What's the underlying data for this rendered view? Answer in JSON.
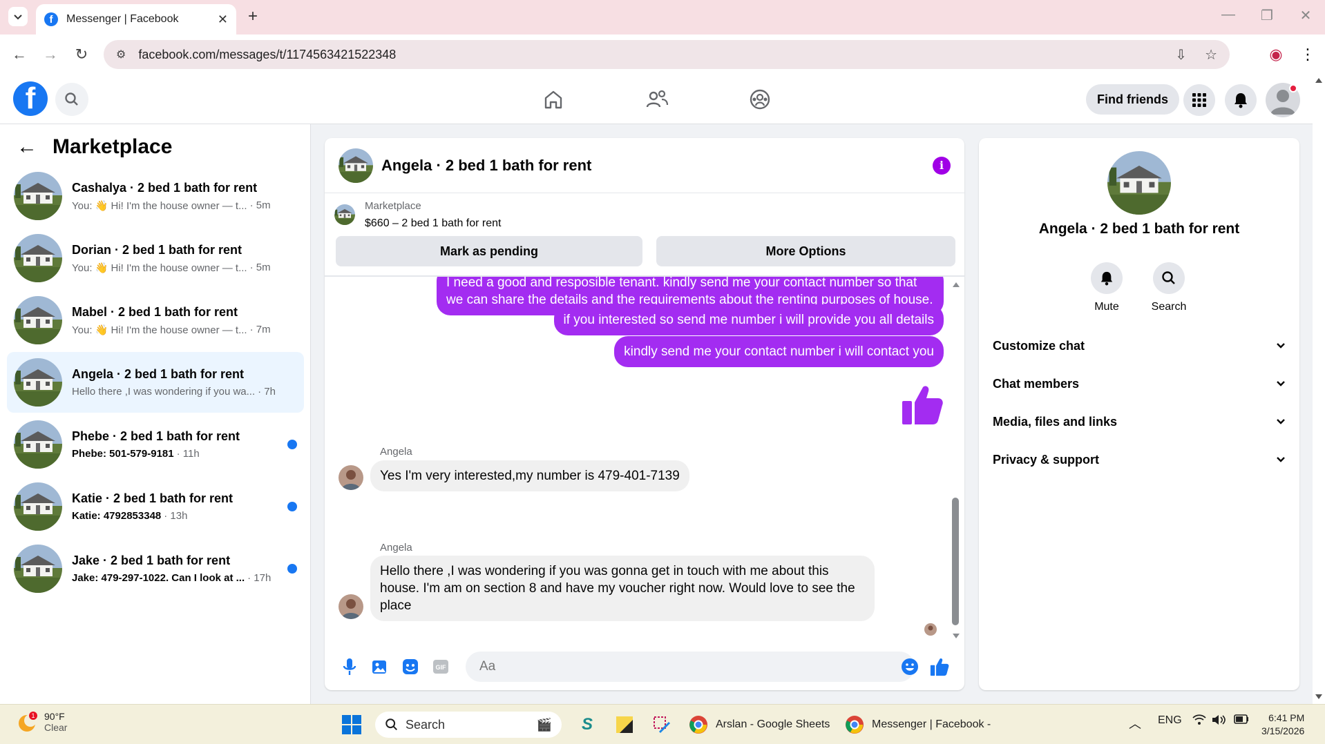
{
  "browser": {
    "tab_title": "Messenger | Facebook",
    "url": "facebook.com/messages/t/1174563421522348"
  },
  "fbnav": {
    "find_friends": "Find friends"
  },
  "sidebar": {
    "title": "Marketplace",
    "conversations": [
      {
        "name": "Cashalya · 2 bed 1 bath for rent",
        "preview": "You: 👋 Hi! I'm the house owner — t...",
        "time": "· 5m",
        "unread": false,
        "active": false
      },
      {
        "name": "Dorian · 2 bed 1 bath for rent",
        "preview": "You: 👋 Hi! I'm the house owner — t...",
        "time": "· 5m",
        "unread": false,
        "active": false
      },
      {
        "name": "Mabel · 2 bed 1 bath for rent",
        "preview": "You: 👋 Hi! I'm the house owner — t...",
        "time": "· 7m",
        "unread": false,
        "active": false
      },
      {
        "name": "Angela · 2 bed 1 bath for rent",
        "preview": "Hello there ,I was wondering if you wa...",
        "time": "· 7h",
        "unread": false,
        "active": true
      },
      {
        "name": "Phebe · 2 bed 1 bath for rent",
        "preview": "Phebe: 501-579-9181",
        "time": "· 11h",
        "unread": true,
        "active": false
      },
      {
        "name": "Katie · 2 bed 1 bath for rent",
        "preview": "Katie: 4792853348",
        "time": "· 13h",
        "unread": true,
        "active": false
      },
      {
        "name": "Jake · 2 bed 1 bath for rent",
        "preview": "Jake: 479-297-1022. Can I look at ...",
        "time": "· 17h",
        "unread": true,
        "active": false
      }
    ]
  },
  "chat": {
    "title": "Angela · 2 bed 1 bath for rent",
    "marketplace_label": "Marketplace",
    "listing": "$660 – 2 bed 1 bath for rent",
    "mark_pending": "Mark as pending",
    "more_options": "More Options",
    "messages": {
      "out1": "I need a good and resposible tenant. kindly send me your contact number so that we can share the details and the requirements about the renting purposes of house.",
      "out2": "if you interested so send me number i will provide you all details",
      "out3": "kindly send me your contact number i will contact you",
      "sender1": "Angela",
      "in1": "Yes I'm very interested,my number is 479-401-7139",
      "sender2": "Angela",
      "in2": "Hello there ,I was wondering if you was gonna get in touch with me about this house. I'm am on section 8 and have my voucher right now. Would love to see the place"
    },
    "composer_placeholder": "Aa"
  },
  "info_panel": {
    "title": "Angela · 2 bed 1 bath for rent",
    "mute": "Mute",
    "search": "Search",
    "items": [
      "Customize chat",
      "Chat members",
      "Media, files and links",
      "Privacy & support"
    ]
  },
  "taskbar": {
    "weather_temp": "90°F",
    "weather_cond": "Clear",
    "search": "Search",
    "app1": "Arslan - Google Sheets",
    "app2": "Messenger | Facebook -",
    "lang": "ENG",
    "time": "6:41 PM",
    "date": "3/15/2026"
  },
  "colors": {
    "fb_blue": "#1877f2",
    "outgoing_bubble": "#a32cf1",
    "info_purple": "#a000e6"
  }
}
